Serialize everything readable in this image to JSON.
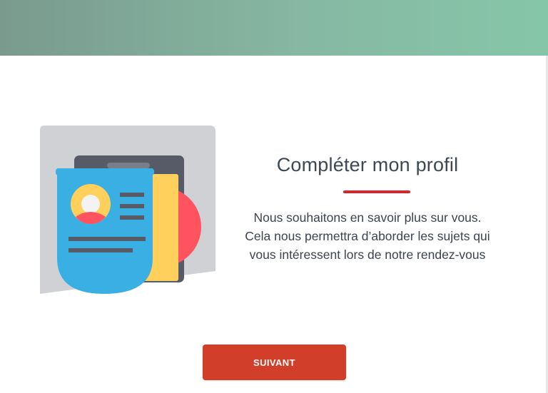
{
  "header": {
    "banner_colors": [
      "#7a9a8e",
      "#86c6a8"
    ]
  },
  "main": {
    "illustration": "profile-card-icon",
    "title": "Compléter mon profil",
    "description_lines": [
      "Nous souhaitons en savoir plus sur vous.",
      "Cela nous permettra d’aborder les sujets qui",
      "vous intéressent lors de notre rendez-vous"
    ],
    "accent_color": "#d9232d"
  },
  "footer": {
    "next_label": "SUIVANT",
    "button_color": "#d13f2b"
  }
}
